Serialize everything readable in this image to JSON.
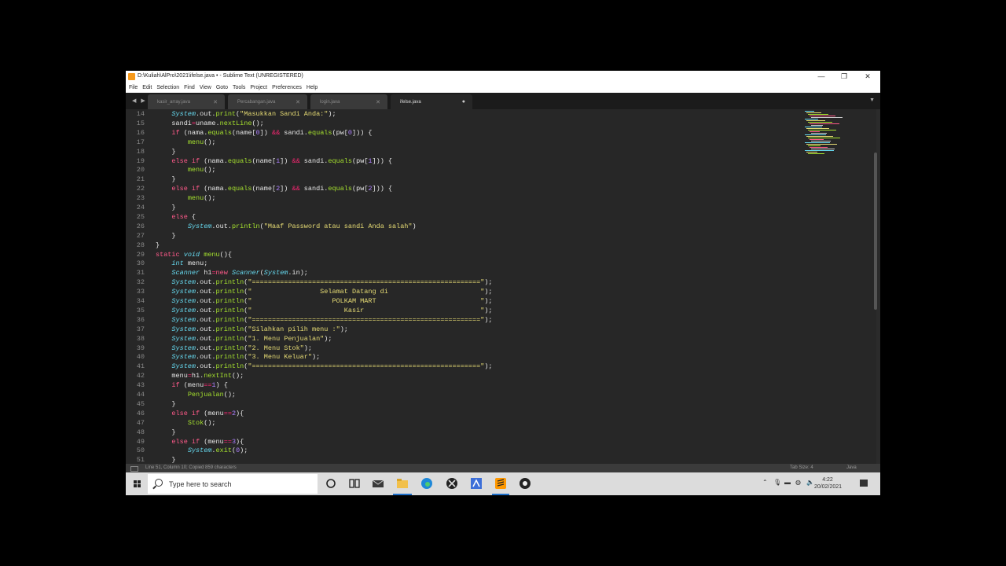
{
  "window": {
    "title": "D:\\Kuliah\\AlPro\\2021\\ifelse.java • - Sublime Text (UNREGISTERED)",
    "controls": [
      "—",
      "❐",
      "✕"
    ]
  },
  "menubar": [
    "File",
    "Edit",
    "Selection",
    "Find",
    "View",
    "Goto",
    "Tools",
    "Project",
    "Preferences",
    "Help"
  ],
  "tabs": [
    {
      "name": "kasir_array.java",
      "active": false
    },
    {
      "name": "Percabangan.java",
      "active": false
    },
    {
      "name": "login.java",
      "active": false
    },
    {
      "name": "ifelse.java",
      "active": true
    }
  ],
  "editor": {
    "line_numbers": [
      "14",
      "15",
      "16",
      "17",
      "18",
      "19",
      "20",
      "21",
      "22",
      "23",
      "24",
      "25",
      "26",
      "27",
      "28",
      "29",
      "30",
      "31",
      "32",
      "33",
      "34",
      "35",
      "36",
      "37",
      "38",
      "39",
      "40",
      "41",
      "42",
      "43",
      "44",
      "45",
      "46",
      "47",
      "48",
      "49",
      "50",
      "51"
    ],
    "lines": [
      [
        [
          "    ",
          ""
        ],
        [
          "System",
          "ty"
        ],
        [
          ".out.",
          ""
        ],
        [
          "print",
          "fn"
        ],
        [
          "(",
          ""
        ],
        [
          "\"Masukkan Sandi Anda:\"",
          "st"
        ],
        [
          ");",
          ""
        ]
      ],
      [
        [
          "    sandi",
          ""
        ],
        [
          "=",
          "op"
        ],
        [
          "uname.",
          ""
        ],
        [
          "nextLine",
          "fn"
        ],
        [
          "();",
          ""
        ]
      ],
      [
        [
          "    ",
          ""
        ],
        [
          "if",
          "kw"
        ],
        [
          " (nama.",
          ""
        ],
        [
          "equals",
          "fn"
        ],
        [
          "(name[",
          ""
        ],
        [
          "0",
          "nu"
        ],
        [
          "]) ",
          ""
        ],
        [
          "&&",
          "op"
        ],
        [
          " sandi.",
          ""
        ],
        [
          "equals",
          "fn"
        ],
        [
          "(pw[",
          ""
        ],
        [
          "0",
          "nu"
        ],
        [
          "])) {",
          ""
        ]
      ],
      [
        [
          "        ",
          ""
        ],
        [
          "menu",
          "fn"
        ],
        [
          "();",
          ""
        ]
      ],
      [
        [
          "    }",
          ""
        ]
      ],
      [
        [
          "    ",
          ""
        ],
        [
          "else",
          "kw"
        ],
        [
          " ",
          ""
        ],
        [
          "if",
          "kw"
        ],
        [
          " (nama.",
          ""
        ],
        [
          "equals",
          "fn"
        ],
        [
          "(name[",
          ""
        ],
        [
          "1",
          "nu"
        ],
        [
          "]) ",
          ""
        ],
        [
          "&&",
          "op"
        ],
        [
          " sandi.",
          ""
        ],
        [
          "equals",
          "fn"
        ],
        [
          "(pw[",
          ""
        ],
        [
          "1",
          "nu"
        ],
        [
          "])) {",
          ""
        ]
      ],
      [
        [
          "        ",
          ""
        ],
        [
          "menu",
          "fn"
        ],
        [
          "();",
          ""
        ]
      ],
      [
        [
          "    }",
          ""
        ]
      ],
      [
        [
          "    ",
          ""
        ],
        [
          "else",
          "kw"
        ],
        [
          " ",
          ""
        ],
        [
          "if",
          "kw"
        ],
        [
          " (nama.",
          ""
        ],
        [
          "equals",
          "fn"
        ],
        [
          "(name[",
          ""
        ],
        [
          "2",
          "nu"
        ],
        [
          "]) ",
          ""
        ],
        [
          "&&",
          "op"
        ],
        [
          " sandi.",
          ""
        ],
        [
          "equals",
          "fn"
        ],
        [
          "(pw[",
          ""
        ],
        [
          "2",
          "nu"
        ],
        [
          "])) {",
          ""
        ]
      ],
      [
        [
          "        ",
          ""
        ],
        [
          "menu",
          "fn"
        ],
        [
          "();",
          ""
        ]
      ],
      [
        [
          "    }",
          ""
        ]
      ],
      [
        [
          "    ",
          ""
        ],
        [
          "else",
          "kw"
        ],
        [
          " {",
          ""
        ]
      ],
      [
        [
          "        ",
          ""
        ],
        [
          "System",
          "ty"
        ],
        [
          ".out.",
          ""
        ],
        [
          "println",
          "fn"
        ],
        [
          "(",
          ""
        ],
        [
          "\"Maaf Password atau sandi Anda salah\"",
          "st"
        ],
        [
          ")",
          ""
        ]
      ],
      [
        [
          "    }",
          ""
        ]
      ],
      [
        [
          "}",
          ""
        ]
      ],
      [
        [
          "static",
          "kw"
        ],
        [
          " ",
          ""
        ],
        [
          "void",
          "ty"
        ],
        [
          " ",
          ""
        ],
        [
          "menu",
          "fn"
        ],
        [
          "(){",
          ""
        ]
      ],
      [
        [
          "    ",
          ""
        ],
        [
          "int",
          "ty"
        ],
        [
          " menu;",
          ""
        ]
      ],
      [
        [
          "    ",
          ""
        ],
        [
          "Scanner",
          "ty"
        ],
        [
          " h1",
          ""
        ],
        [
          "=",
          "op"
        ],
        [
          "new",
          "kw"
        ],
        [
          " ",
          ""
        ],
        [
          "Scanner",
          "ty"
        ],
        [
          "(",
          ""
        ],
        [
          "System",
          "ty"
        ],
        [
          ".in);",
          ""
        ]
      ],
      [
        [
          "    ",
          ""
        ],
        [
          "System",
          "ty"
        ],
        [
          ".out.",
          ""
        ],
        [
          "println",
          "fn"
        ],
        [
          "(",
          ""
        ],
        [
          "\"=========================================================\"",
          "st"
        ],
        [
          ");",
          ""
        ]
      ],
      [
        [
          "    ",
          ""
        ],
        [
          "System",
          "ty"
        ],
        [
          ".out.",
          ""
        ],
        [
          "println",
          "fn"
        ],
        [
          "(",
          ""
        ],
        [
          "\"                 Selamat Datang di                       \"",
          "st"
        ],
        [
          ");",
          ""
        ]
      ],
      [
        [
          "    ",
          ""
        ],
        [
          "System",
          "ty"
        ],
        [
          ".out.",
          ""
        ],
        [
          "println",
          "fn"
        ],
        [
          "(",
          ""
        ],
        [
          "\"                    POLKAM MART                          \"",
          "st"
        ],
        [
          ");",
          ""
        ]
      ],
      [
        [
          "    ",
          ""
        ],
        [
          "System",
          "ty"
        ],
        [
          ".out.",
          ""
        ],
        [
          "println",
          "fn"
        ],
        [
          "(",
          ""
        ],
        [
          "\"                       Kasir                             \"",
          "st"
        ],
        [
          ");",
          ""
        ]
      ],
      [
        [
          "    ",
          ""
        ],
        [
          "System",
          "ty"
        ],
        [
          ".out.",
          ""
        ],
        [
          "println",
          "fn"
        ],
        [
          "(",
          ""
        ],
        [
          "\"=========================================================\"",
          "st"
        ],
        [
          ");",
          ""
        ]
      ],
      [
        [
          "    ",
          ""
        ],
        [
          "System",
          "ty"
        ],
        [
          ".out.",
          ""
        ],
        [
          "println",
          "fn"
        ],
        [
          "(",
          ""
        ],
        [
          "\"Silahkan pilih menu :\"",
          "st"
        ],
        [
          ");",
          ""
        ]
      ],
      [
        [
          "    ",
          ""
        ],
        [
          "System",
          "ty"
        ],
        [
          ".out.",
          ""
        ],
        [
          "println",
          "fn"
        ],
        [
          "(",
          ""
        ],
        [
          "\"1. Menu Penjualan\"",
          "st"
        ],
        [
          ");",
          ""
        ]
      ],
      [
        [
          "    ",
          ""
        ],
        [
          "System",
          "ty"
        ],
        [
          ".out.",
          ""
        ],
        [
          "println",
          "fn"
        ],
        [
          "(",
          ""
        ],
        [
          "\"2. Menu Stok\"",
          "st"
        ],
        [
          ");",
          ""
        ]
      ],
      [
        [
          "    ",
          ""
        ],
        [
          "System",
          "ty"
        ],
        [
          ".out.",
          ""
        ],
        [
          "println",
          "fn"
        ],
        [
          "(",
          ""
        ],
        [
          "\"3. Menu Keluar\"",
          "st"
        ],
        [
          ");",
          ""
        ]
      ],
      [
        [
          "    ",
          ""
        ],
        [
          "System",
          "ty"
        ],
        [
          ".out.",
          ""
        ],
        [
          "println",
          "fn"
        ],
        [
          "(",
          ""
        ],
        [
          "\"=========================================================\"",
          "st"
        ],
        [
          ");",
          ""
        ]
      ],
      [
        [
          "    menu",
          ""
        ],
        [
          "=",
          "op"
        ],
        [
          "h1.",
          ""
        ],
        [
          "nextInt",
          "fn"
        ],
        [
          "();",
          ""
        ]
      ],
      [
        [
          "    ",
          ""
        ],
        [
          "if",
          "kw"
        ],
        [
          " (menu",
          ""
        ],
        [
          "==",
          "op"
        ],
        [
          "1",
          "nu"
        ],
        [
          ") {",
          ""
        ]
      ],
      [
        [
          "        ",
          ""
        ],
        [
          "Penjualan",
          "fn"
        ],
        [
          "();",
          ""
        ]
      ],
      [
        [
          "    }",
          ""
        ]
      ],
      [
        [
          "    ",
          ""
        ],
        [
          "else",
          "kw"
        ],
        [
          " ",
          ""
        ],
        [
          "if",
          "kw"
        ],
        [
          " (menu",
          ""
        ],
        [
          "==",
          "op"
        ],
        [
          "2",
          "nu"
        ],
        [
          "){",
          ""
        ]
      ],
      [
        [
          "        ",
          ""
        ],
        [
          "Stok",
          "fn"
        ],
        [
          "();",
          ""
        ]
      ],
      [
        [
          "    }",
          ""
        ]
      ],
      [
        [
          "    ",
          ""
        ],
        [
          "else",
          "kw"
        ],
        [
          " ",
          ""
        ],
        [
          "if",
          "kw"
        ],
        [
          " (menu",
          ""
        ],
        [
          "==",
          "op"
        ],
        [
          "3",
          "nu"
        ],
        [
          "){",
          ""
        ]
      ],
      [
        [
          "        ",
          ""
        ],
        [
          "System",
          "ty"
        ],
        [
          ".",
          ""
        ],
        [
          "exit",
          "fn"
        ],
        [
          "(",
          ""
        ],
        [
          "0",
          "nu"
        ],
        [
          ");",
          ""
        ]
      ],
      [
        [
          "    }",
          ""
        ]
      ]
    ]
  },
  "statusbar": {
    "message": "Line 51, Column 10; Copied 859 characters",
    "tab_size": "Tab Size: 4",
    "syntax": "Java"
  },
  "taskbar": {
    "search_placeholder": "Type here to search",
    "time": "4:22",
    "date": "20/02/2021"
  },
  "colors": {
    "editor_bg": "#272727",
    "keyword": "#ff5a8a",
    "type": "#66d9ef",
    "function": "#a6e22e",
    "string": "#e6db74",
    "number": "#ae81ff"
  }
}
